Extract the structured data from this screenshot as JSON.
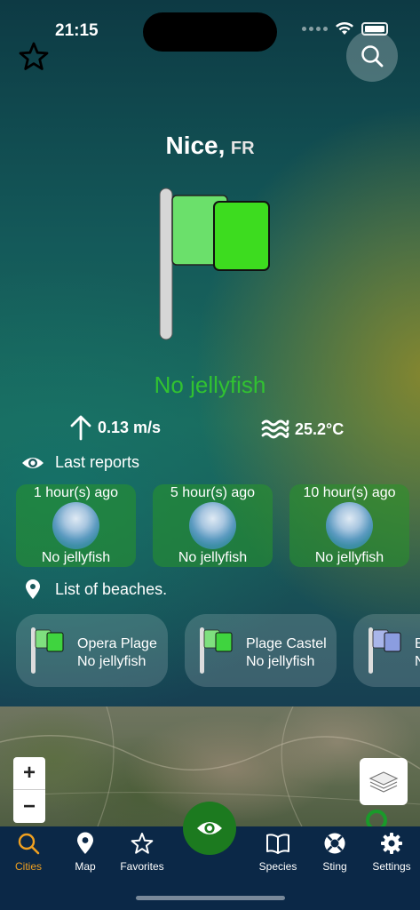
{
  "status_bar": {
    "time": "21:15"
  },
  "header": {
    "city": "Nice,",
    "country": "FR"
  },
  "current": {
    "status": "No jellyfish",
    "status_color": "#31c231",
    "wind": "0.13 m/s",
    "water_temp": "25.2°C"
  },
  "reports": {
    "title": "Last reports",
    "items": [
      {
        "time": "1 hour(s) ago",
        "label": "No jellyfish"
      },
      {
        "time": "5 hour(s) ago",
        "label": "No jellyfish"
      },
      {
        "time": "10 hour(s) ago",
        "label": "No jellyfish"
      }
    ]
  },
  "beaches": {
    "title": "List of beaches.",
    "items": [
      {
        "name": "Opera Plage",
        "status": "No jellyfish",
        "flag_color": "#3fd43f"
      },
      {
        "name": "Plage Castel",
        "status": "No jellyfish",
        "flag_color": "#3fd43f"
      },
      {
        "name": "B",
        "status": "N",
        "flag_color": "#8b9de0"
      }
    ]
  },
  "map": {
    "zoom_in": "+",
    "zoom_out": "−"
  },
  "tabs": [
    {
      "label": "Cities",
      "icon": "search-icon",
      "active": true
    },
    {
      "label": "Map",
      "icon": "map-pin-icon"
    },
    {
      "label": "Favorites",
      "icon": "star-icon"
    },
    {
      "label": "Species",
      "icon": "book-icon"
    },
    {
      "label": "Sting",
      "icon": "lifebuoy-icon"
    },
    {
      "label": "Settings",
      "icon": "gear-icon"
    }
  ],
  "colors": {
    "accent": "#f0a020",
    "tabbar": "#0b2847",
    "fab": "#1c7a1f"
  }
}
